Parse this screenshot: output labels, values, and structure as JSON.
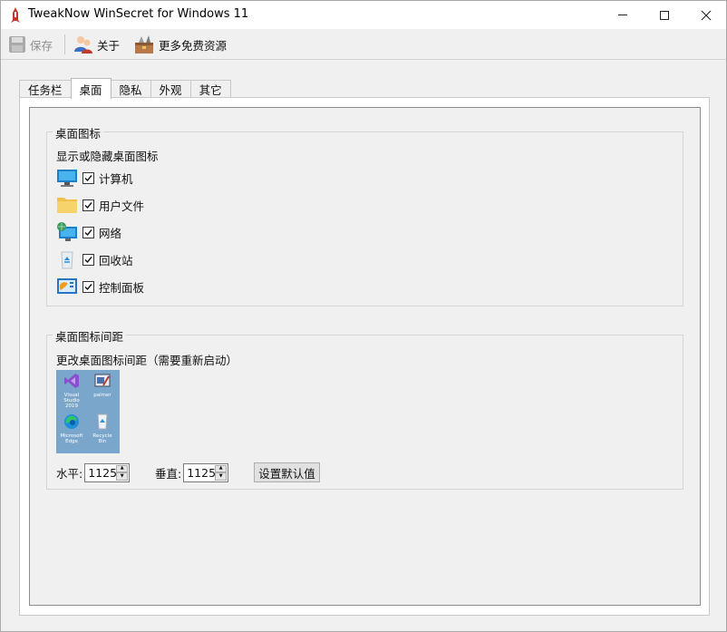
{
  "window": {
    "title": "TweakNow WinSecret for Windows 11"
  },
  "toolbar": {
    "save_label": "保存",
    "about_label": "关于",
    "more_label": "更多免费资源"
  },
  "tabs": [
    {
      "label": "任务栏"
    },
    {
      "label": "桌面",
      "active": true
    },
    {
      "label": "隐私"
    },
    {
      "label": "外观"
    },
    {
      "label": "其它"
    }
  ],
  "desktop_icons": {
    "group_title": "桌面图标",
    "subtitle": "显示或隐藏桌面图标",
    "items": [
      {
        "label": "计算机",
        "checked": true,
        "icon": "computer-icon"
      },
      {
        "label": "用户文件",
        "checked": true,
        "icon": "folder-icon"
      },
      {
        "label": "网络",
        "checked": true,
        "icon": "network-icon"
      },
      {
        "label": "回收站",
        "checked": true,
        "icon": "recycle-bin-icon"
      },
      {
        "label": "控制面板",
        "checked": true,
        "icon": "control-panel-icon"
      }
    ]
  },
  "icon_spacing": {
    "group_title": "桌面图标间距",
    "subtitle": "更改桌面图标间距（需要重新启动）",
    "preview_icons": [
      {
        "label": "Visual Studio 2019"
      },
      {
        "label": "palmer"
      },
      {
        "label": "Microsoft Edge"
      },
      {
        "label": "Recycle Bin"
      }
    ],
    "horizontal_label": "水平:",
    "horizontal_value": "1125",
    "vertical_label": "垂直:",
    "vertical_value": "1125",
    "reset_label": "设置默认值"
  }
}
